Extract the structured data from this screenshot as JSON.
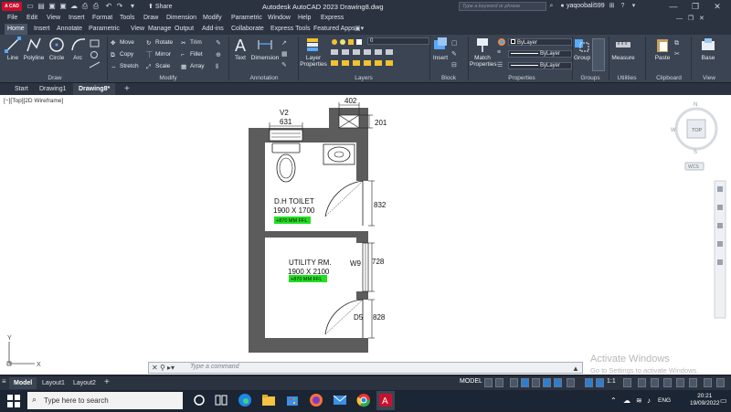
{
  "titlebar": {
    "app_badge": "A CAD",
    "share_label": "Share",
    "title": "Autodesk AutoCAD 2023    Drawing8.dwg",
    "search_placeholder": "Type a keyword or phrase",
    "username": "yaqoobali599"
  },
  "menu": [
    "File",
    "Edit",
    "View",
    "Insert",
    "Format",
    "Tools",
    "Draw",
    "Dimension",
    "Modify",
    "Parametric",
    "Window",
    "Help",
    "Express"
  ],
  "ribbon_tabs": [
    "Home",
    "Insert",
    "Annotate",
    "Parametric",
    "View",
    "Manage",
    "Output",
    "Add-ins",
    "Collaborate",
    "Express Tools",
    "Featured Apps"
  ],
  "ribbon": {
    "draw": {
      "title": "Draw",
      "tools": [
        "Line",
        "Polyline",
        "Circle",
        "Arc"
      ]
    },
    "modify": {
      "title": "Modify",
      "tools": [
        "Move",
        "Rotate",
        "Trim",
        "Copy",
        "Mirror",
        "Fillet",
        "Stretch",
        "Scale",
        "Array"
      ]
    },
    "annotation": {
      "title": "Annotation",
      "tools": [
        "Text",
        "Dimension"
      ]
    },
    "layers": {
      "title": "Layers",
      "layer_props": "Layer Properties",
      "current_layer": "0"
    },
    "block": {
      "title": "Block",
      "insert": "Insert"
    },
    "properties": {
      "title": "Properties",
      "match": "Match Properties",
      "bylayer1": "ByLayer",
      "bylayer2": "ByLayer",
      "bylayer3": "ByLayer"
    },
    "groups": {
      "title": "Groups",
      "group": "Group"
    },
    "utilities": {
      "title": "Utilities",
      "measure": "Measure"
    },
    "clipboard": {
      "title": "Clipboard",
      "paste": "Paste"
    },
    "view": {
      "title": "View",
      "base": "Base"
    }
  },
  "file_tabs": [
    "Start",
    "Drawing1",
    "Drawing8*"
  ],
  "viewport_label": "[−][Top][2D Wireframe]",
  "drawing": {
    "dim_402": "402",
    "dim_201": "201",
    "v2_label": "V2",
    "dim_631": "631",
    "toilet_name": "D.H TOILET",
    "toilet_size": "1900 X 1700",
    "toilet_ffl": "+870 MM FFL",
    "dim_832": "832",
    "utility_name": "UTILITY RM.",
    "utility_size": "1900 X 2100",
    "utility_ffl": "+870 MM FFL",
    "w9_label": "W9",
    "dim_728": "728",
    "d5_label": "D5",
    "dim_828": "828",
    "ucs_y": "Y",
    "ucs_x": "X"
  },
  "viewcube": {
    "top": "TOP",
    "n": "N",
    "w": "W",
    "s": "S",
    "wcs": "WCS"
  },
  "command": {
    "placeholder": "Type a command"
  },
  "layout_tabs": [
    "Model",
    "Layout1",
    "Layout2"
  ],
  "status": {
    "model": "MODEL",
    "scale": "1:1"
  },
  "activate": {
    "line1": "Activate Windows",
    "line2": "Go to Settings to activate Windows."
  },
  "taskbar": {
    "search_placeholder": "Type here to search",
    "lang": "ENG",
    "time": "20:21",
    "date": "19/09/2022"
  },
  "colors": {
    "ffl_green": "#22dd22",
    "accent_blue": "#2e7dd1",
    "autocad_red": "#c8102e"
  }
}
